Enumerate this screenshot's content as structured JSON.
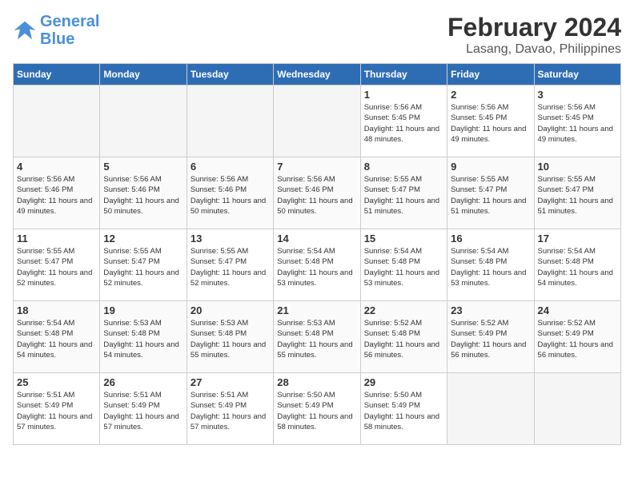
{
  "header": {
    "logo_line1": "General",
    "logo_line2": "Blue",
    "month_year": "February 2024",
    "location": "Lasang, Davao, Philippines"
  },
  "weekdays": [
    "Sunday",
    "Monday",
    "Tuesday",
    "Wednesday",
    "Thursday",
    "Friday",
    "Saturday"
  ],
  "weeks": [
    [
      {
        "day": "",
        "empty": true
      },
      {
        "day": "",
        "empty": true
      },
      {
        "day": "",
        "empty": true
      },
      {
        "day": "",
        "empty": true
      },
      {
        "day": "1",
        "sunrise": "5:56 AM",
        "sunset": "5:45 PM",
        "daylight": "11 hours and 48 minutes."
      },
      {
        "day": "2",
        "sunrise": "5:56 AM",
        "sunset": "5:45 PM",
        "daylight": "11 hours and 49 minutes."
      },
      {
        "day": "3",
        "sunrise": "5:56 AM",
        "sunset": "5:45 PM",
        "daylight": "11 hours and 49 minutes."
      }
    ],
    [
      {
        "day": "4",
        "sunrise": "5:56 AM",
        "sunset": "5:46 PM",
        "daylight": "11 hours and 49 minutes."
      },
      {
        "day": "5",
        "sunrise": "5:56 AM",
        "sunset": "5:46 PM",
        "daylight": "11 hours and 50 minutes."
      },
      {
        "day": "6",
        "sunrise": "5:56 AM",
        "sunset": "5:46 PM",
        "daylight": "11 hours and 50 minutes."
      },
      {
        "day": "7",
        "sunrise": "5:56 AM",
        "sunset": "5:46 PM",
        "daylight": "11 hours and 50 minutes."
      },
      {
        "day": "8",
        "sunrise": "5:55 AM",
        "sunset": "5:47 PM",
        "daylight": "11 hours and 51 minutes."
      },
      {
        "day": "9",
        "sunrise": "5:55 AM",
        "sunset": "5:47 PM",
        "daylight": "11 hours and 51 minutes."
      },
      {
        "day": "10",
        "sunrise": "5:55 AM",
        "sunset": "5:47 PM",
        "daylight": "11 hours and 51 minutes."
      }
    ],
    [
      {
        "day": "11",
        "sunrise": "5:55 AM",
        "sunset": "5:47 PM",
        "daylight": "11 hours and 52 minutes."
      },
      {
        "day": "12",
        "sunrise": "5:55 AM",
        "sunset": "5:47 PM",
        "daylight": "11 hours and 52 minutes."
      },
      {
        "day": "13",
        "sunrise": "5:55 AM",
        "sunset": "5:47 PM",
        "daylight": "11 hours and 52 minutes."
      },
      {
        "day": "14",
        "sunrise": "5:54 AM",
        "sunset": "5:48 PM",
        "daylight": "11 hours and 53 minutes."
      },
      {
        "day": "15",
        "sunrise": "5:54 AM",
        "sunset": "5:48 PM",
        "daylight": "11 hours and 53 minutes."
      },
      {
        "day": "16",
        "sunrise": "5:54 AM",
        "sunset": "5:48 PM",
        "daylight": "11 hours and 53 minutes."
      },
      {
        "day": "17",
        "sunrise": "5:54 AM",
        "sunset": "5:48 PM",
        "daylight": "11 hours and 54 minutes."
      }
    ],
    [
      {
        "day": "18",
        "sunrise": "5:54 AM",
        "sunset": "5:48 PM",
        "daylight": "11 hours and 54 minutes."
      },
      {
        "day": "19",
        "sunrise": "5:53 AM",
        "sunset": "5:48 PM",
        "daylight": "11 hours and 54 minutes."
      },
      {
        "day": "20",
        "sunrise": "5:53 AM",
        "sunset": "5:48 PM",
        "daylight": "11 hours and 55 minutes."
      },
      {
        "day": "21",
        "sunrise": "5:53 AM",
        "sunset": "5:48 PM",
        "daylight": "11 hours and 55 minutes."
      },
      {
        "day": "22",
        "sunrise": "5:52 AM",
        "sunset": "5:48 PM",
        "daylight": "11 hours and 56 minutes."
      },
      {
        "day": "23",
        "sunrise": "5:52 AM",
        "sunset": "5:49 PM",
        "daylight": "11 hours and 56 minutes."
      },
      {
        "day": "24",
        "sunrise": "5:52 AM",
        "sunset": "5:49 PM",
        "daylight": "11 hours and 56 minutes."
      }
    ],
    [
      {
        "day": "25",
        "sunrise": "5:51 AM",
        "sunset": "5:49 PM",
        "daylight": "11 hours and 57 minutes."
      },
      {
        "day": "26",
        "sunrise": "5:51 AM",
        "sunset": "5:49 PM",
        "daylight": "11 hours and 57 minutes."
      },
      {
        "day": "27",
        "sunrise": "5:51 AM",
        "sunset": "5:49 PM",
        "daylight": "11 hours and 57 minutes."
      },
      {
        "day": "28",
        "sunrise": "5:50 AM",
        "sunset": "5:49 PM",
        "daylight": "11 hours and 58 minutes."
      },
      {
        "day": "29",
        "sunrise": "5:50 AM",
        "sunset": "5:49 PM",
        "daylight": "11 hours and 58 minutes."
      },
      {
        "day": "",
        "empty": true
      },
      {
        "day": "",
        "empty": true
      }
    ]
  ],
  "labels": {
    "sunrise": "Sunrise:",
    "sunset": "Sunset:",
    "daylight": "Daylight:"
  }
}
